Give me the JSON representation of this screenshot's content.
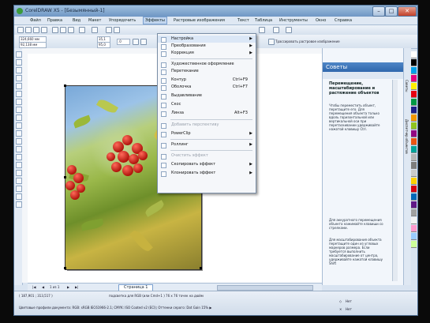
{
  "window": {
    "title": "CorelDRAW X5 - [Безымянный-1]",
    "buttons": {
      "minimize": "–",
      "maximize": "□",
      "close": "✕"
    }
  },
  "menubar": {
    "items": [
      "Файл",
      "Правка",
      "Вид",
      "Макет",
      "Упорядочить",
      "Эффекты",
      "Растровые изображения",
      "Текст",
      "Таблица",
      "Инструменты",
      "Окно",
      "Справка"
    ]
  },
  "propbar": {
    "x": "324,660 мм",
    "y": "92,138 мм",
    "w": "35,1",
    "h": "95,0",
    "rotation": ".0",
    "wrap_text": "Трассировать растровое изображение"
  },
  "effects_menu": {
    "items": [
      {
        "label": "Настройка",
        "shortcut": "",
        "submenu": true,
        "disabled": false
      },
      {
        "label": "Преобразования",
        "shortcut": "",
        "submenu": true,
        "disabled": false
      },
      {
        "label": "Коррекция",
        "shortcut": "",
        "submenu": true,
        "disabled": false
      },
      {
        "label": "Художественное оформление",
        "shortcut": "",
        "submenu": false,
        "disabled": false
      },
      {
        "label": "Перетекание",
        "shortcut": "",
        "submenu": false,
        "disabled": false
      },
      {
        "label": "Контур",
        "shortcut": "Ctrl+F9",
        "submenu": false,
        "disabled": false
      },
      {
        "label": "Оболочка",
        "shortcut": "Ctrl+F7",
        "submenu": false,
        "disabled": false
      },
      {
        "label": "Выдавливание",
        "shortcut": "",
        "submenu": false,
        "disabled": false
      },
      {
        "label": "Скос",
        "shortcut": "",
        "submenu": false,
        "disabled": false
      },
      {
        "label": "Линза",
        "shortcut": "Alt+F3",
        "submenu": false,
        "disabled": false
      },
      {
        "label": "Добавить перспективу",
        "shortcut": "",
        "submenu": false,
        "disabled": true
      },
      {
        "label": "PowerClip",
        "shortcut": "",
        "submenu": true,
        "disabled": false
      },
      {
        "label": "Роллинг",
        "shortcut": "",
        "submenu": true,
        "disabled": false
      },
      {
        "label": "Очистить эффект",
        "shortcut": "",
        "submenu": false,
        "disabled": true
      },
      {
        "label": "Скопировать эффект",
        "shortcut": "",
        "submenu": true,
        "disabled": false
      },
      {
        "label": "Клонировать эффект",
        "shortcut": "",
        "submenu": true,
        "disabled": false
      }
    ]
  },
  "docker": {
    "title": "Советы",
    "heading": "Перемещение, масштабирование и растяжение объектов",
    "paragraphs": [
      "Чтобы переместить объект, перетащите его. Для перемещения объекта только вдоль горизонтальной или вертикальной оси при перетаскивании удерживайте нажатой клавишу Ctrl.",
      "Для аккуратного перемещения объекта нажимайте клавиши со стрелками.",
      "Для масштабирования объекта перетащите один из угловых маркеров размера. Если требуется выполнить масштабирование от центра, удерживайте нажатой клавишу Shift"
    ],
    "side_tabs": [
      "Советы",
      "Диспетчер объектов"
    ]
  },
  "pagenav": {
    "page_counter": "1 из 1",
    "page_tab": "Страница 1"
  },
  "status": {
    "coords": "( 187,901 ; 313,517 )",
    "line1": "подсветка для RGB (или Cmd+1 ) 76 x 76 точек на дюйм",
    "line2": "Цветовые профили документа: RGB: sRGB IEC61966-2.1; CMYK: ISO Coated v2 (ECI); Оттенки серого: Dot Gain 15% ▶",
    "fill_label": "Нет",
    "outline_label": "Нет"
  },
  "palette_colors": [
    "#ffffff",
    "#000000",
    "#00a0e9",
    "#e4007f",
    "#fff100",
    "#e60012",
    "#009944",
    "#1d2088",
    "#f39800",
    "#8fc31f",
    "#920783",
    "#ea5514",
    "#00a29a",
    "#b5b5b6",
    "#7d7d7d",
    "#c9caca",
    "#fdd000",
    "#d7000f",
    "#0068b7",
    "#601986",
    "#a0a0a0",
    "#f2f2f2",
    "#ff99cc",
    "#99ccff",
    "#ccff99"
  ]
}
